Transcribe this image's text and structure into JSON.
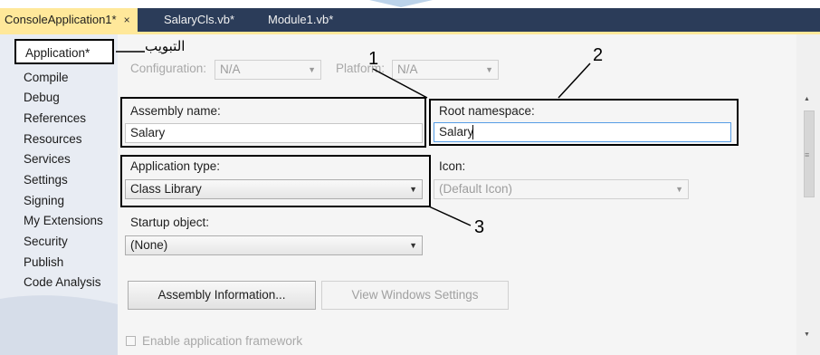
{
  "tabs": [
    {
      "label": "ConsoleApplication1*",
      "active": true
    },
    {
      "label": "SalaryCls.vb*",
      "active": false
    },
    {
      "label": "Module1.vb*",
      "active": false
    }
  ],
  "tab_close_glyph": "×",
  "nav": [
    "Application*",
    "Compile",
    "Debug",
    "References",
    "Resources",
    "Services",
    "Settings",
    "Signing",
    "My Extensions",
    "Security",
    "Publish",
    "Code Analysis"
  ],
  "config": {
    "configuration_label": "Configuration:",
    "configuration_value": "N/A",
    "platform_label": "Platform:",
    "platform_value": "N/A"
  },
  "assembly_name": {
    "label": "Assembly name:",
    "value": "Salary"
  },
  "root_namespace": {
    "label": "Root namespace:",
    "value": "Salary"
  },
  "application_type": {
    "label": "Application type:",
    "value": "Class Library"
  },
  "icon": {
    "label": "Icon:",
    "value": "(Default Icon)"
  },
  "startup_object": {
    "label": "Startup object:",
    "value": "(None)"
  },
  "buttons": {
    "assembly_information": "Assembly Information...",
    "view_windows_settings": "View Windows Settings"
  },
  "enable_framework_label": "Enable application framework",
  "annotations": {
    "arabic_label": "التبويب",
    "callout_1": "1",
    "callout_2": "2",
    "callout_3": "3"
  },
  "colors": {
    "tabbar": "#2b3c59",
    "active_tab": "#ffe89a",
    "left_nav": "#e8ecf3",
    "panel": "#f5f5f5"
  },
  "icons": [
    "close-icon",
    "dropdown-arrow-icon",
    "scroll-up-icon",
    "scroll-down-icon",
    "checkbox-icon"
  ]
}
